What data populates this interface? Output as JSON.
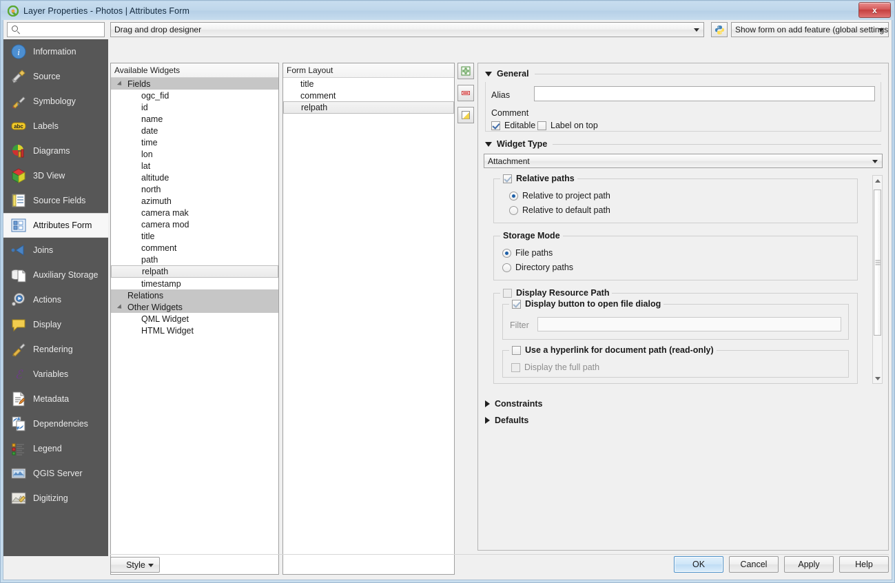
{
  "window": {
    "title": "Layer Properties - Photos | Attributes Form",
    "app_icon": "qgis-logo-icon",
    "close_label": "x"
  },
  "nav": {
    "search_placeholder": "",
    "search_value": "",
    "items": [
      {
        "label": "Information",
        "icon": "information-icon"
      },
      {
        "label": "Source",
        "icon": "source-icon"
      },
      {
        "label": "Symbology",
        "icon": "symbology-icon"
      },
      {
        "label": "Labels",
        "icon": "labels-icon"
      },
      {
        "label": "Diagrams",
        "icon": "diagrams-icon"
      },
      {
        "label": "3D View",
        "icon": "3d-view-icon"
      },
      {
        "label": "Source Fields",
        "icon": "source-fields-icon"
      },
      {
        "label": "Attributes Form",
        "icon": "attributes-form-icon"
      },
      {
        "label": "Joins",
        "icon": "joins-icon"
      },
      {
        "label": "Auxiliary Storage",
        "icon": "auxiliary-storage-icon"
      },
      {
        "label": "Actions",
        "icon": "actions-icon"
      },
      {
        "label": "Display",
        "icon": "display-icon"
      },
      {
        "label": "Rendering",
        "icon": "rendering-icon"
      },
      {
        "label": "Variables",
        "icon": "variables-icon"
      },
      {
        "label": "Metadata",
        "icon": "metadata-icon"
      },
      {
        "label": "Dependencies",
        "icon": "dependencies-icon"
      },
      {
        "label": "Legend",
        "icon": "legend-icon"
      },
      {
        "label": "QGIS Server",
        "icon": "qgis-server-icon"
      },
      {
        "label": "Digitizing",
        "icon": "digitizing-icon"
      }
    ],
    "selected": "Attributes Form"
  },
  "toolbar": {
    "designer_mode": "Drag and drop designer",
    "python_button": "python-init-code-icon",
    "form_mode": "Show form on add feature (global settings)"
  },
  "available_widgets": {
    "header": "Available Widgets",
    "tree": [
      {
        "label": "Fields",
        "type": "group",
        "expanded": true
      },
      {
        "label": "ogc_fid",
        "type": "leaf"
      },
      {
        "label": "id",
        "type": "leaf"
      },
      {
        "label": "name",
        "type": "leaf"
      },
      {
        "label": "date",
        "type": "leaf"
      },
      {
        "label": "time",
        "type": "leaf"
      },
      {
        "label": "lon",
        "type": "leaf"
      },
      {
        "label": "lat",
        "type": "leaf"
      },
      {
        "label": "altitude",
        "type": "leaf"
      },
      {
        "label": "north",
        "type": "leaf"
      },
      {
        "label": "azimuth",
        "type": "leaf"
      },
      {
        "label": "camera mak",
        "type": "leaf"
      },
      {
        "label": "camera mod",
        "type": "leaf"
      },
      {
        "label": "title",
        "type": "leaf"
      },
      {
        "label": "comment",
        "type": "leaf"
      },
      {
        "label": "path",
        "type": "leaf"
      },
      {
        "label": "relpath",
        "type": "leaf",
        "selected": true
      },
      {
        "label": "timestamp",
        "type": "leaf"
      },
      {
        "label": "Relations",
        "type": "group",
        "expanded": false
      },
      {
        "label": "Other Widgets",
        "type": "group",
        "expanded": true
      },
      {
        "label": "QML Widget",
        "type": "leaf"
      },
      {
        "label": "HTML Widget",
        "type": "leaf"
      }
    ]
  },
  "form_layout": {
    "header": "Form Layout",
    "rows": [
      {
        "label": "title"
      },
      {
        "label": "comment"
      },
      {
        "label": "relpath",
        "selected": true
      }
    ],
    "buttons": [
      {
        "name": "add-container-button",
        "icon": "green-plus-icon"
      },
      {
        "name": "remove-button",
        "icon": "red-minus-icon"
      },
      {
        "name": "edit-button",
        "icon": "yellow-edit-icon"
      }
    ]
  },
  "properties": {
    "general": {
      "title": "General",
      "expanded": true,
      "alias_label": "Alias",
      "alias_value": "",
      "comment_label": "Comment",
      "editable_label": "Editable",
      "editable_checked": true,
      "label_on_top_label": "Label on top",
      "label_on_top_checked": false
    },
    "widget_type": {
      "title": "Widget Type",
      "expanded": true,
      "selected": "Attachment",
      "relative_paths": {
        "title": "Relative paths",
        "checked": true,
        "options": [
          {
            "label": "Relative to project path",
            "selected": true
          },
          {
            "label": "Relative to default path",
            "selected": false
          }
        ]
      },
      "storage_mode": {
        "title": "Storage Mode",
        "options": [
          {
            "label": "File paths",
            "selected": true
          },
          {
            "label": "Directory paths",
            "selected": false
          }
        ]
      },
      "display_resource_path": {
        "title": "Display Resource Path",
        "checked": false
      },
      "display_button_file_dialog": {
        "title": "Display button to open file dialog",
        "checked": true,
        "filter_label": "Filter",
        "filter_value": ""
      },
      "hyperlink": {
        "title": "Use a hyperlink for document path (read-only)",
        "checked": false,
        "full_path_label": "Display the full path",
        "full_path_checked": false
      }
    },
    "constraints": {
      "title": "Constraints",
      "expanded": false
    },
    "defaults": {
      "title": "Defaults",
      "expanded": false
    }
  },
  "footer": {
    "style_label": "Style",
    "ok_label": "OK",
    "cancel_label": "Cancel",
    "apply_label": "Apply",
    "help_label": "Help"
  },
  "colors": {
    "titlebar": "#bed6ea",
    "nav_bg": "#575757",
    "panel_bg": "#f0f0f0",
    "group_row": "#c6c6c6",
    "accent_blue": "#1d5fa8",
    "default_button": "#cfe6f8"
  }
}
